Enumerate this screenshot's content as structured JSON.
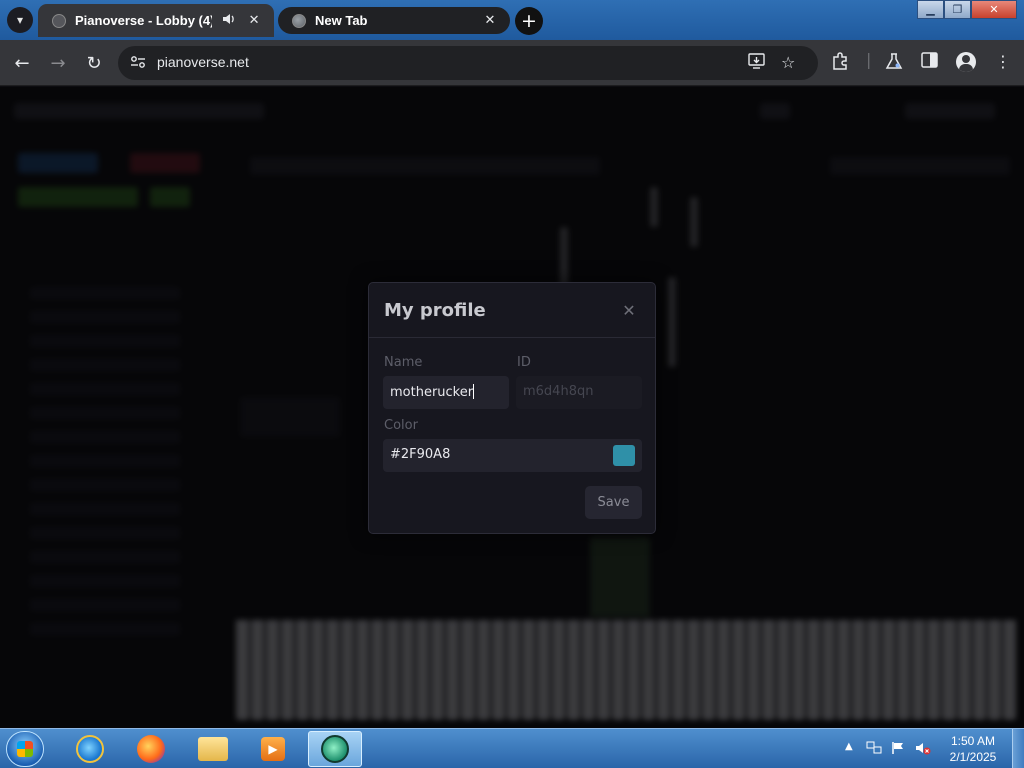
{
  "browser": {
    "tabs": [
      {
        "title": "Pianoverse - Lobby (4)",
        "audio": true,
        "active": true
      },
      {
        "title": "New Tab",
        "active": false
      }
    ],
    "url": "pianoverse.net",
    "icons": {
      "tab_search": "chevron-down-icon",
      "audio": "speaker-icon",
      "close": "close-icon",
      "new_tab": "plus-icon",
      "back": "back-arrow-icon",
      "forward": "forward-arrow-icon",
      "reload": "reload-icon",
      "site_info": "tune-icon",
      "install": "install-app-icon",
      "bookmark": "star-icon",
      "extensions": "puzzle-icon",
      "labs": "flask-icon",
      "side_panel": "side-panel-icon",
      "profile": "profile-icon",
      "menu": "more-vert-icon"
    }
  },
  "modal": {
    "title": "My profile",
    "name_label": "Name",
    "name_value": "motherucker",
    "id_label": "ID",
    "id_value": "m6d4h8qn",
    "color_label": "Color",
    "color_value": "#2F90A8",
    "swatch_color": "#2F90A8",
    "save_label": "Save"
  },
  "taskbar": {
    "time": "1:50 AM",
    "date": "2/1/2025",
    "apps": [
      "internet-explorer",
      "firefox",
      "file-explorer",
      "media-player",
      "pianoverse-app"
    ]
  }
}
